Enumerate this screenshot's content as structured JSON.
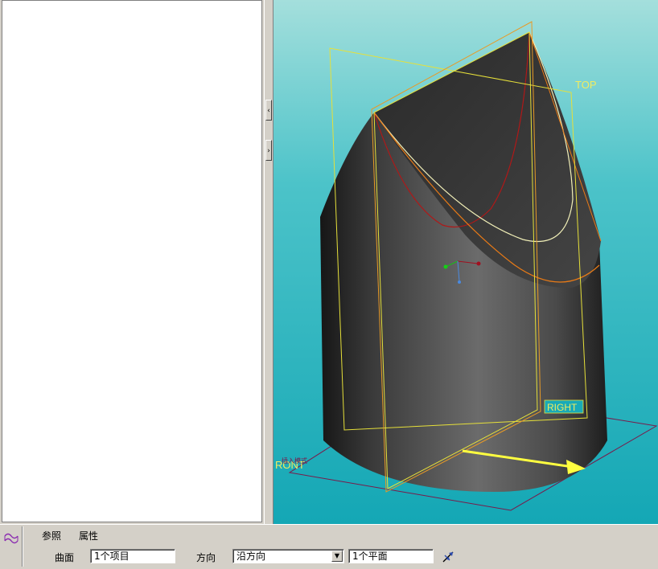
{
  "splitter": {
    "collapse_glyph": "‹",
    "expand_glyph": "›"
  },
  "viewport": {
    "background": "#19aab8",
    "datum_labels": {
      "top": "TOP",
      "right": "RIGHT",
      "front": "RONT",
      "insert": "插入模式"
    }
  },
  "dashboard": {
    "icon": "surface-feature-icon",
    "tabs": {
      "references": "参照",
      "properties": "属性"
    },
    "surface_label": "曲面",
    "surface_value": "1个项目",
    "direction_label": "方向",
    "direction_value": "沿方向",
    "plane_value": "1个平面",
    "flip_icon": "flip-direction-icon"
  }
}
